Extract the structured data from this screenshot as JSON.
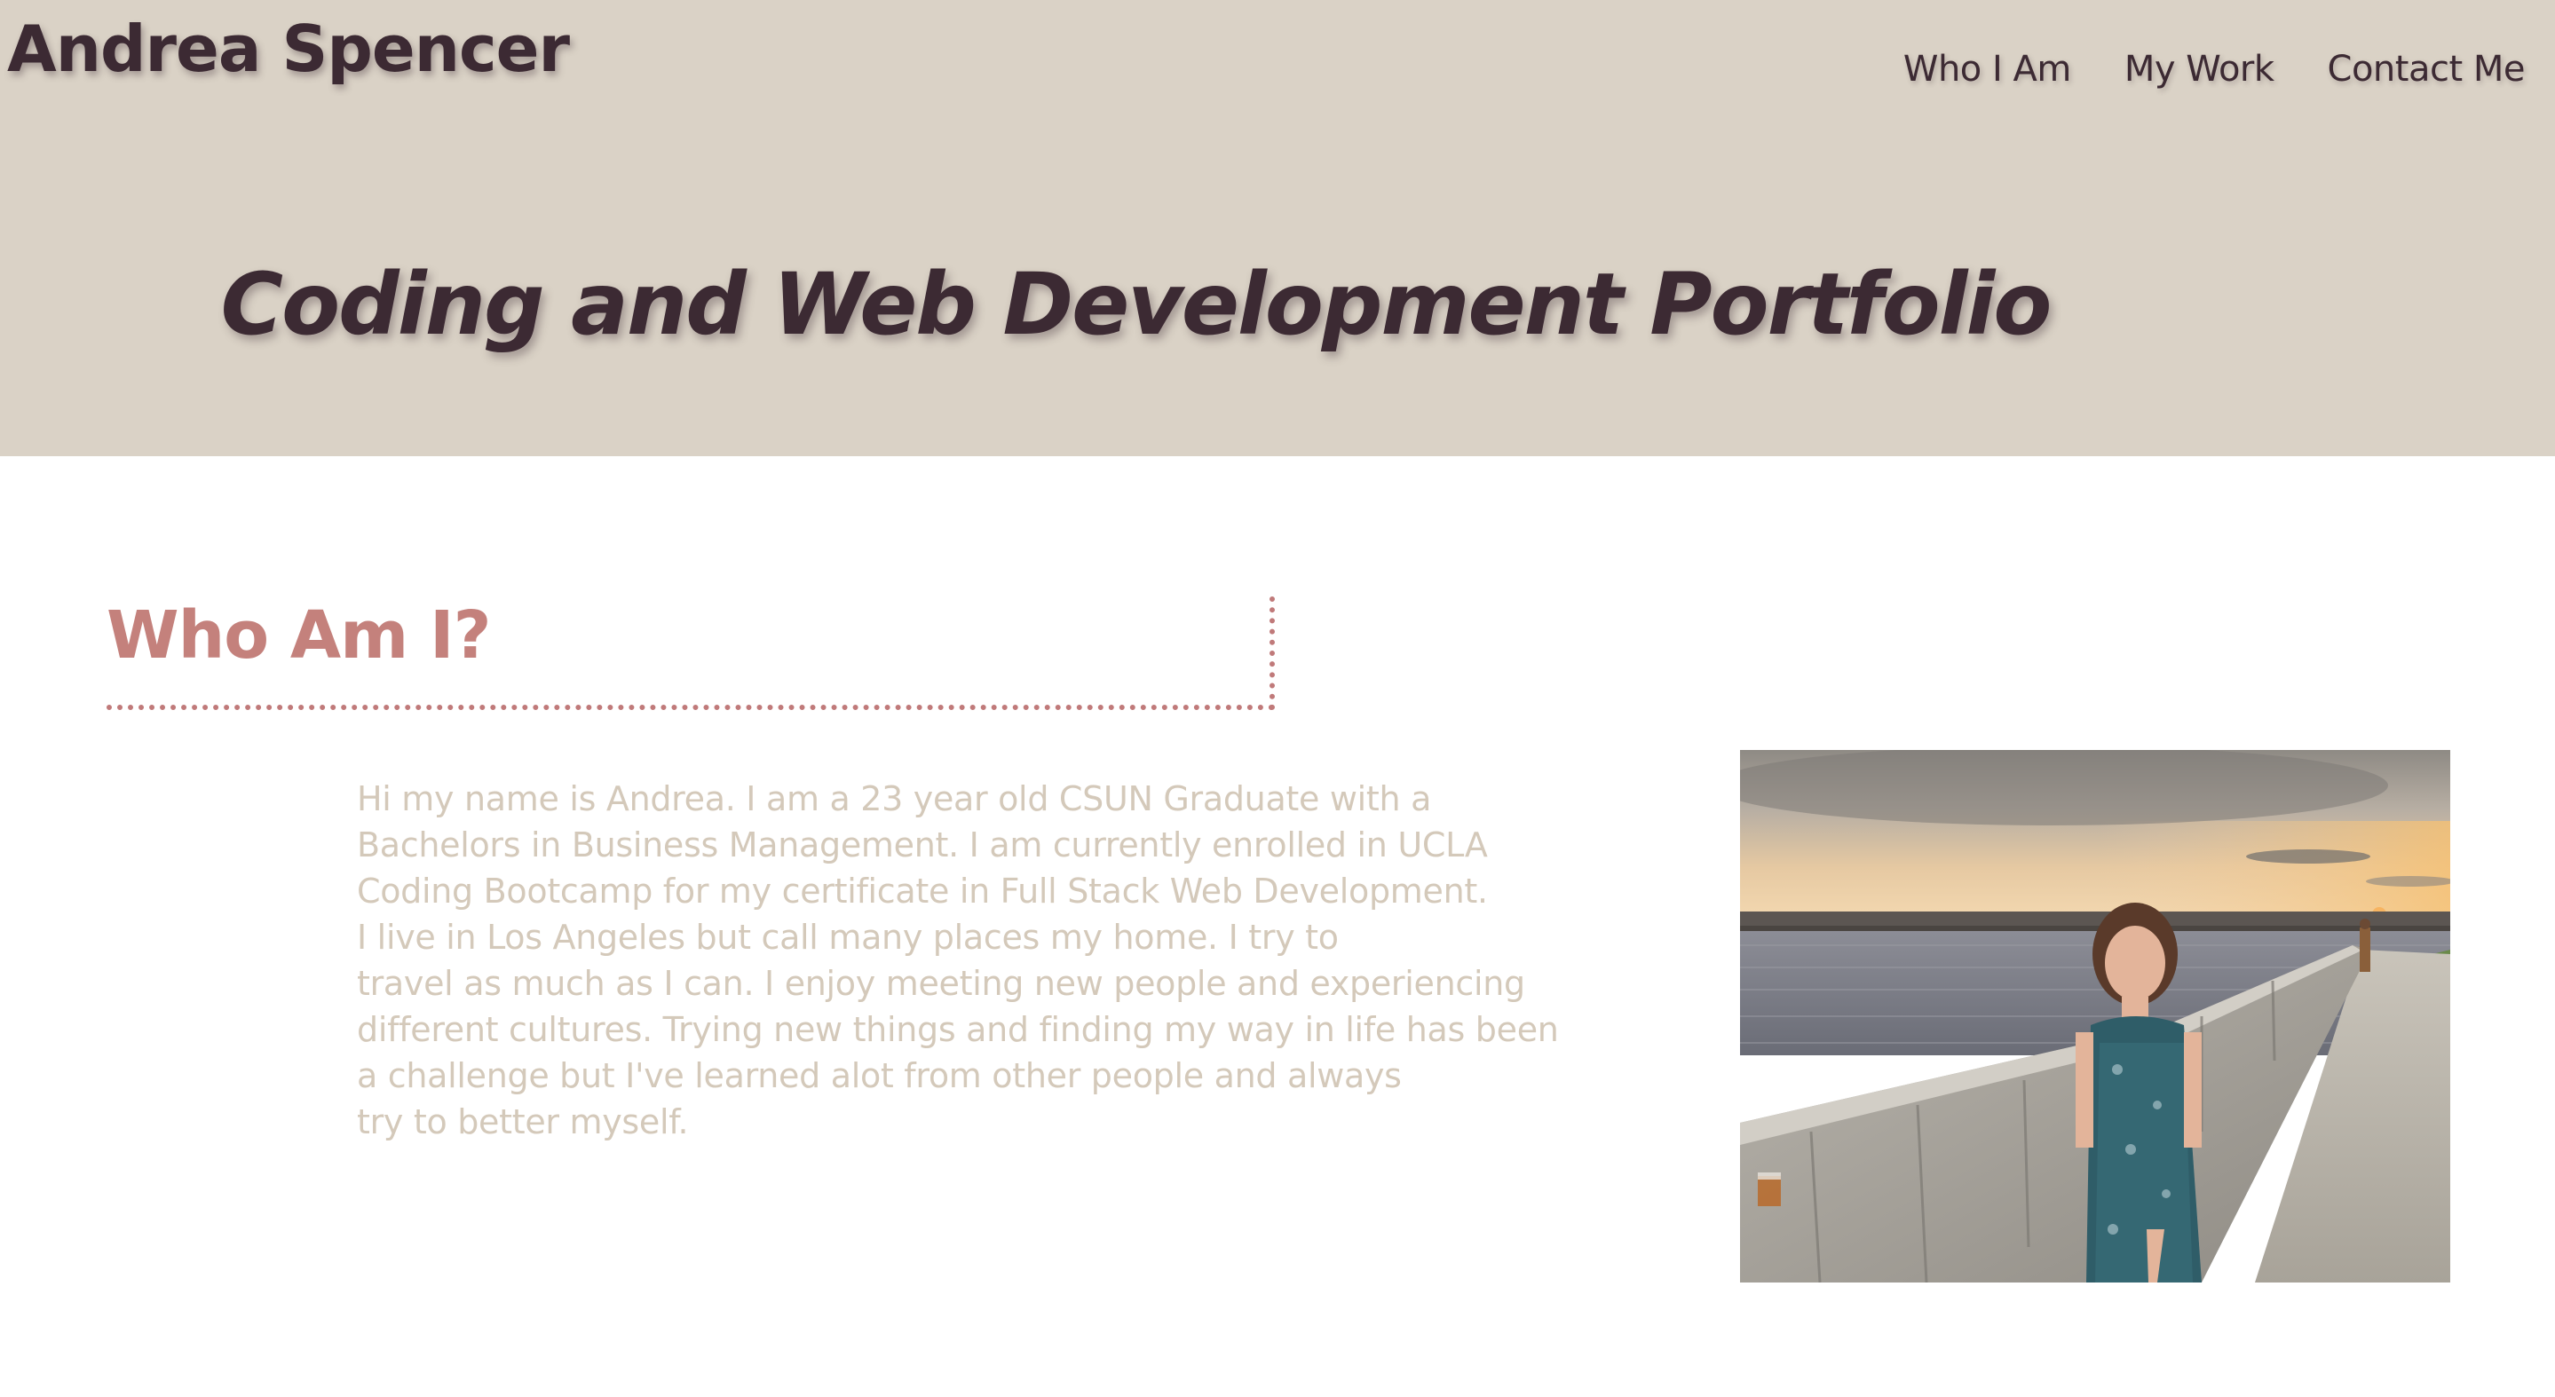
{
  "header": {
    "site_name": "Andrea Spencer",
    "nav": [
      {
        "label": "Who I Am"
      },
      {
        "label": "My Work"
      },
      {
        "label": "Contact Me"
      }
    ],
    "hero_title": "Coding and Web Development Portfolio"
  },
  "about": {
    "heading": "Who Am I?",
    "bio_lines": [
      "Hi my name is Andrea. I am a 23 year old CSUN Graduate with a",
      "Bachelors in Business Management. I am currently enrolled in UCLA",
      "Coding Bootcamp for my certificate in Full Stack Web Development.",
      "I live in Los Angeles but call many places my home. I try to",
      "travel as much as I can. I enjoy meeting new people and experiencing",
      "different cultures. Trying new things and finding my way in life has been",
      "a challenge but I've learned alot from other people and always",
      "try to better myself."
    ]
  },
  "colors": {
    "header_background": "#dad2c6",
    "header_text": "#3c2a33",
    "heading_accent": "#c4817c",
    "dotted_border": "#c07a7a",
    "bio_text": "#d4c9ba"
  }
}
